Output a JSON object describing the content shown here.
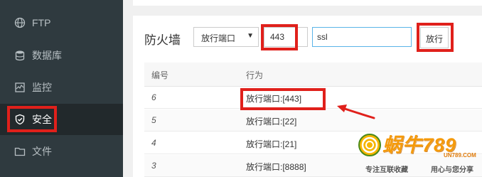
{
  "sidebar": {
    "items": [
      {
        "label": "FTP",
        "icon": "globe-icon"
      },
      {
        "label": "数据库",
        "icon": "database-icon"
      },
      {
        "label": "监控",
        "icon": "monitor-icon"
      },
      {
        "label": "安全",
        "icon": "shield-icon"
      },
      {
        "label": "文件",
        "icon": "folder-icon"
      }
    ],
    "active_index": 3
  },
  "firewall": {
    "title": "防火墙",
    "select_value": "放行端口",
    "port_value": "443",
    "note_value": "ssl",
    "allow_button": "放行"
  },
  "table": {
    "headers": {
      "id": "编号",
      "action": "行为"
    },
    "rows": [
      {
        "id": "6",
        "action": "放行端口:[443]"
      },
      {
        "id": "5",
        "action": "放行端口:[22]"
      },
      {
        "id": "4",
        "action": "放行端口:[21]"
      },
      {
        "id": "3",
        "action": "放行端口:[8888]"
      }
    ]
  },
  "watermark": {
    "title": "蜗牛789",
    "url": "UN789.COM",
    "slogan_left": "专注互联收藏",
    "slogan_right": "用心与您分享"
  },
  "colors": {
    "sidebar_bg": "#2f3a3f",
    "highlight_red": "#e0201b",
    "input_focus": "#5ab4e8",
    "watermark_orange": "#f59a0a"
  }
}
